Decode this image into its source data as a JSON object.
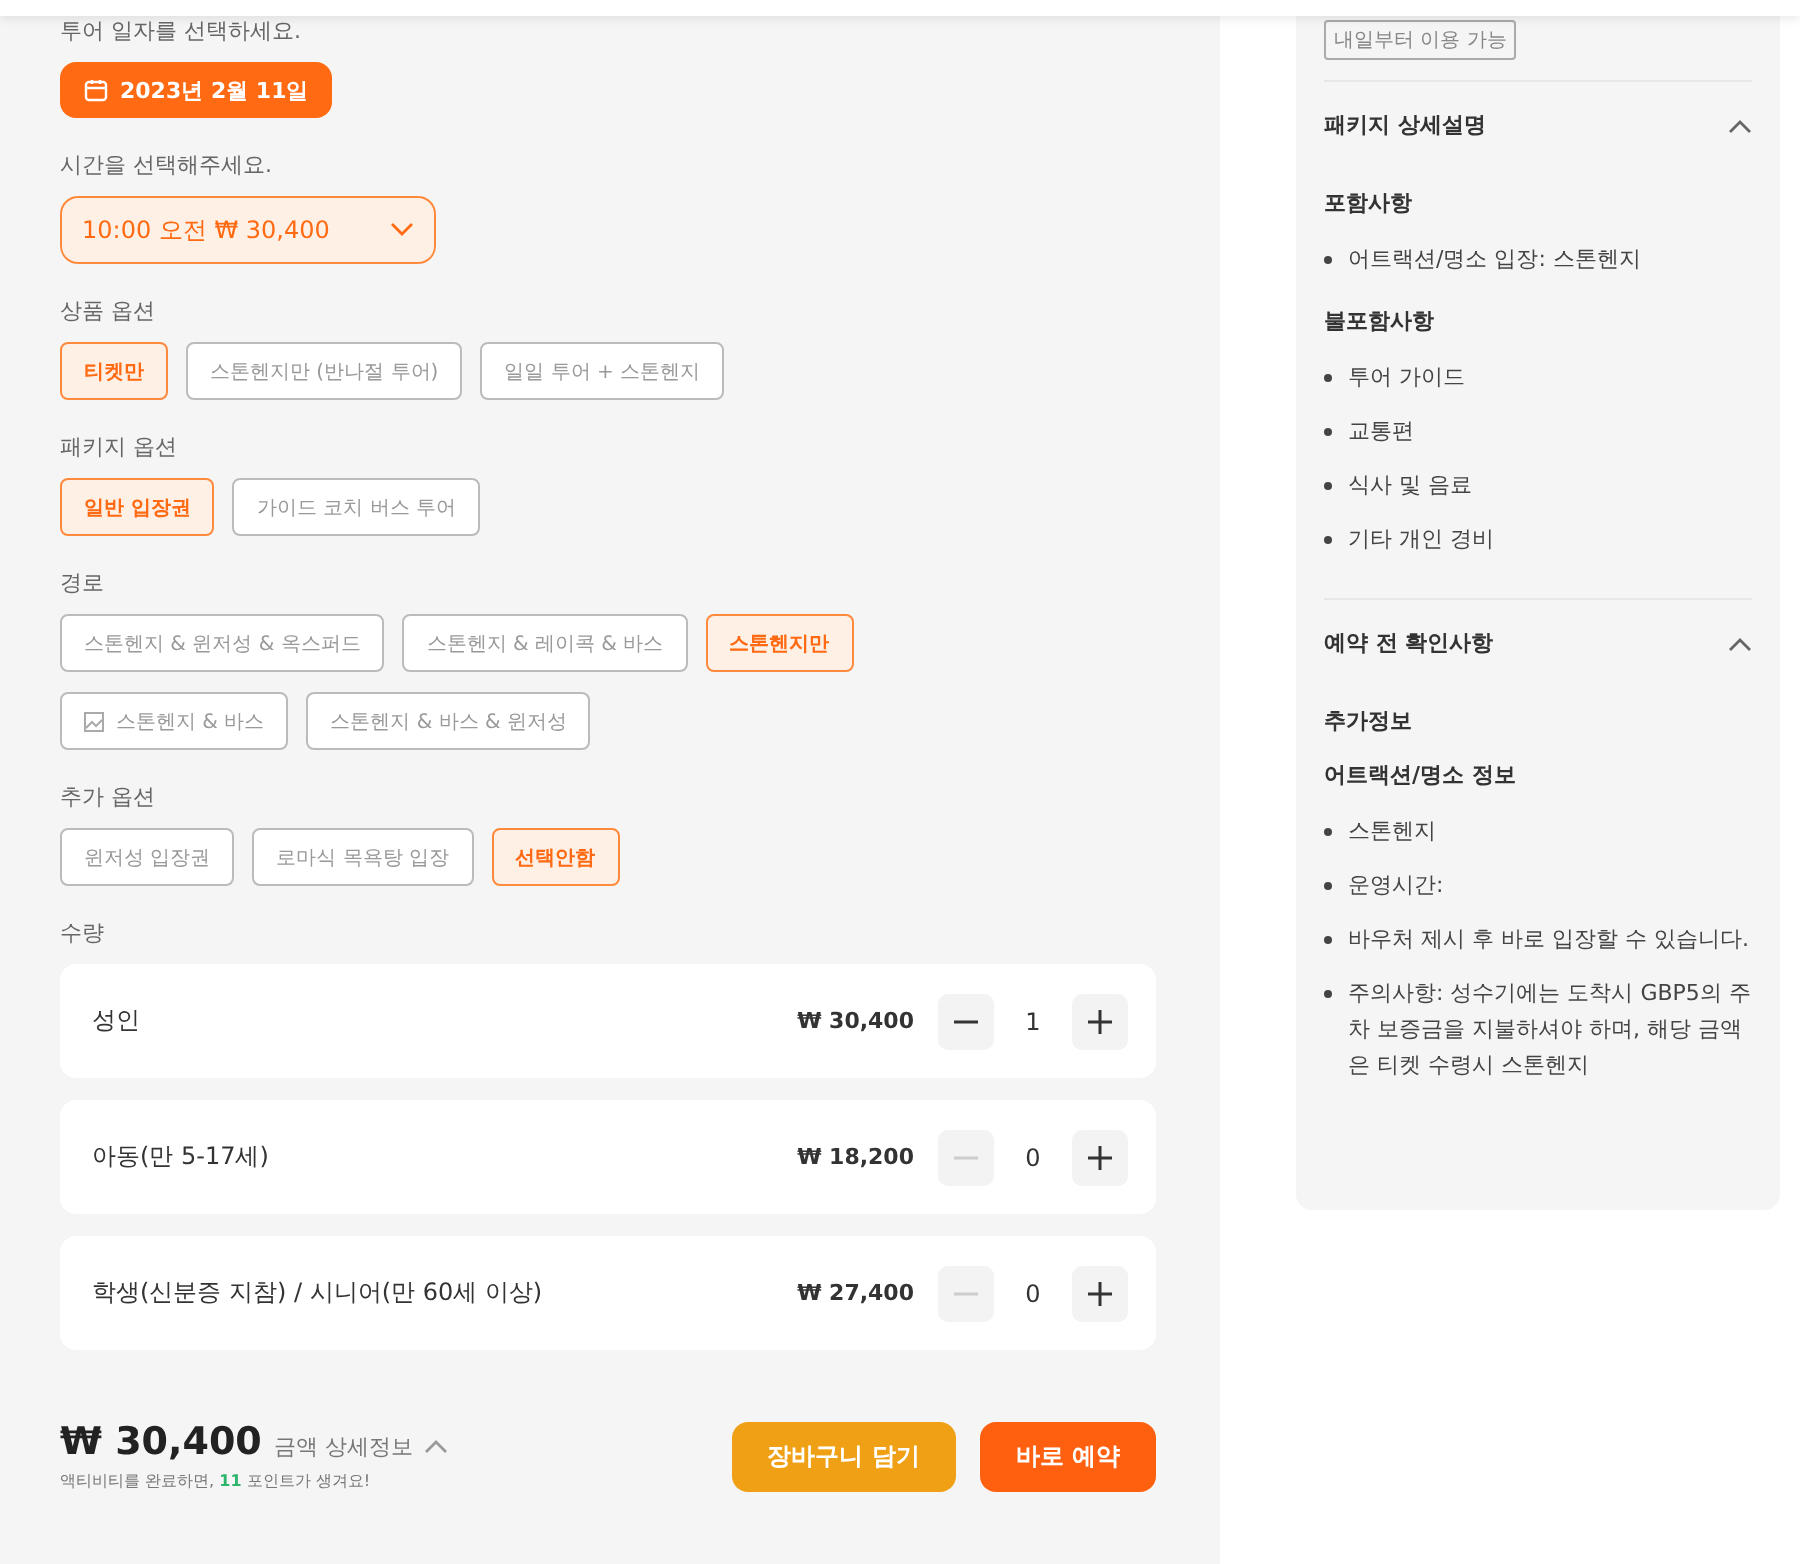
{
  "date_section": {
    "label": "투어 일자를 선택하세요.",
    "date": "2023년 2월 11일"
  },
  "time_section": {
    "label": "시간을 선택해주세요.",
    "value": "10:00 오전 ₩ 30,400"
  },
  "option_groups": [
    {
      "label": "상품 옵션",
      "options": [
        {
          "label": "티켓만",
          "selected": true
        },
        {
          "label": "스톤헨지만 (반나절 투어)",
          "selected": false
        },
        {
          "label": "일일 투어 + 스톤헨지",
          "selected": false
        }
      ]
    },
    {
      "label": "패키지 옵션",
      "options": [
        {
          "label": "일반 입장권",
          "selected": true
        },
        {
          "label": "가이드 코치 버스 투어",
          "selected": false
        }
      ]
    },
    {
      "label": "경로",
      "options": [
        {
          "label": "스톤헨지 & 윈저성 & 옥스퍼드",
          "selected": false
        },
        {
          "label": "스톤헨지 & 레이콕 & 바스",
          "selected": false
        },
        {
          "label": "스톤헨지만",
          "selected": true
        },
        {
          "label": "스톤헨지 & 바스",
          "selected": false,
          "icon": true
        },
        {
          "label": "스톤헨지 & 바스 & 윈저성",
          "selected": false
        }
      ]
    },
    {
      "label": "추가 옵션",
      "options": [
        {
          "label": "윈저성 입장권",
          "selected": false
        },
        {
          "label": "로마식 목욕탕 입장",
          "selected": false
        },
        {
          "label": "선택안함",
          "selected": true
        }
      ]
    }
  ],
  "quantity": {
    "label": "수량",
    "rows": [
      {
        "name": "성인",
        "price": "₩ 30,400",
        "count": "1",
        "minus_disabled": false
      },
      {
        "name": "아동(만 5-17세)",
        "price": "₩ 18,200",
        "count": "0",
        "minus_disabled": true
      },
      {
        "name": "학생(신분증 지참) / 시니어(만 60세 이상)",
        "price": "₩ 27,400",
        "count": "0",
        "minus_disabled": true
      }
    ]
  },
  "footer": {
    "total": "₩ 30,400",
    "detail_link": "금액 상세정보",
    "points_note": "액티비티를 완료하면, **11** 포인트가 생겨요!",
    "cart_button": "장바구니 담기",
    "book_button": "바로 예약"
  },
  "sidebar": {
    "badge": "내일부터 이용 가능",
    "sections": [
      {
        "title": "패키지 상세설명",
        "expanded": true,
        "blocks": [
          {
            "heading": "포함사항",
            "items": [
              "어트랙션/명소 입장: 스톤헨지"
            ]
          },
          {
            "heading": "불포함사항",
            "items": [
              "투어 가이드",
              "교통편",
              "식사 및 음료",
              "기타 개인 경비"
            ]
          }
        ]
      },
      {
        "title": "예약 전 확인사항",
        "expanded": true,
        "blocks": [
          {
            "heading": "추가정보"
          },
          {
            "heading": "어트랙션/명소 정보",
            "items": [
              "스톤헨지",
              "운영시간:",
              "바우처 제시 후 바로 입장할 수 있습니다.",
              "주의사항: 성수기에는 도착시 GBP5의 주차 보증금을 지불하셔야 하며, 해당 금액은 티켓 수령시 스톤헨지"
            ]
          }
        ]
      }
    ]
  }
}
